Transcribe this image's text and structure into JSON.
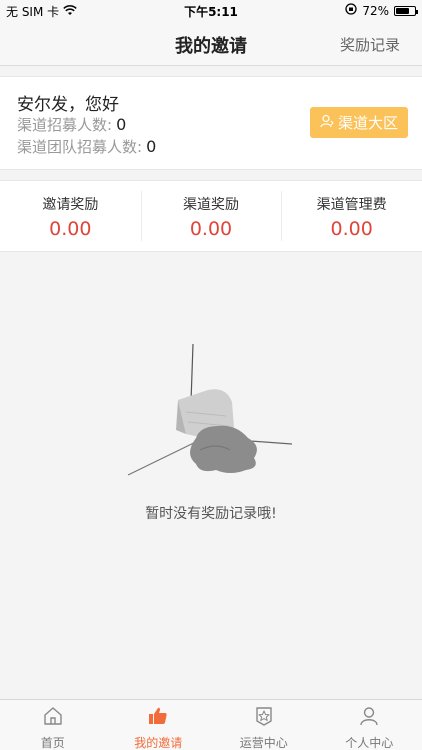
{
  "status_bar": {
    "carrier": "无 SIM 卡",
    "time": "下午5:11",
    "battery": "72%",
    "battery_level": 0.72
  },
  "nav": {
    "title": "我的邀请",
    "right_link": "奖励记录"
  },
  "greeting": {
    "title": "安尔发，您好",
    "channel_recruits_label": "渠道招募人数:",
    "channel_recruits_value": "0",
    "team_recruits_label": "渠道团队招募人数:",
    "team_recruits_value": "0",
    "channel_button": "渠道大区"
  },
  "stats": [
    {
      "label": "邀请奖励",
      "value": "0.00"
    },
    {
      "label": "渠道奖励",
      "value": "0.00"
    },
    {
      "label": "渠道管理费",
      "value": "0.00"
    }
  ],
  "empty": {
    "message": "暂时没有奖励记录哦!"
  },
  "tabs": [
    {
      "label": "首页",
      "icon": "home-icon"
    },
    {
      "label": "我的邀请",
      "icon": "thumbs-up-icon"
    },
    {
      "label": "运营中心",
      "icon": "star-badge-icon"
    },
    {
      "label": "个人中心",
      "icon": "user-icon"
    }
  ],
  "colors": {
    "accent": "#f26b3a",
    "button": "#fbc25a",
    "value_red": "#e0453b"
  }
}
